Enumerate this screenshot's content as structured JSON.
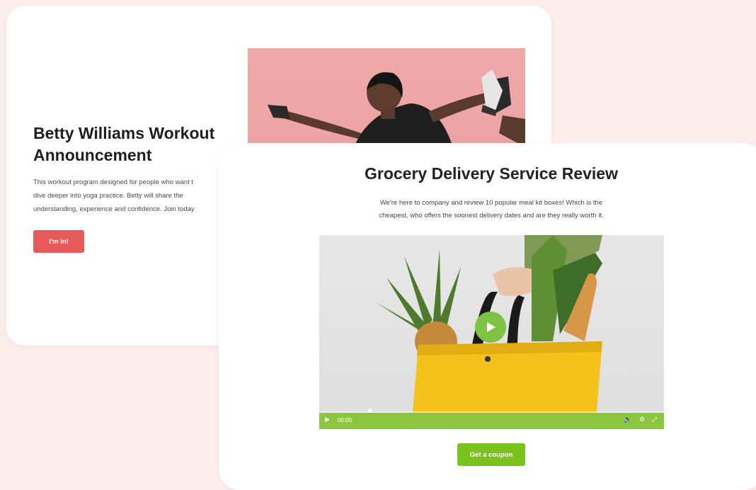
{
  "workout_card": {
    "title_line1": "Betty Williams Workout",
    "title_line2": "Announcement",
    "desc_line1": "This workout program designed for people who want t",
    "desc_line2": "dive deeper into yoga practice. Betty will share the",
    "desc_line3": "understanding, experience and confidence. Join today",
    "button_label": "I'm in!"
  },
  "grocery_card": {
    "title": "Grocery Delivery Service Review",
    "desc_line1": "We're here to company and review 10 popular meal kit boxes! Which is the",
    "desc_line2": "cheapest, who offers the soonest delivery dates and are they really worth it.",
    "video": {
      "time": "00:00"
    },
    "button_label": "Get a coupon"
  },
  "colors": {
    "background": "#fdeeee",
    "workout_accent": "#e65a5a",
    "grocery_accent": "#7cc21f",
    "video_bar": "#8cc63f"
  }
}
